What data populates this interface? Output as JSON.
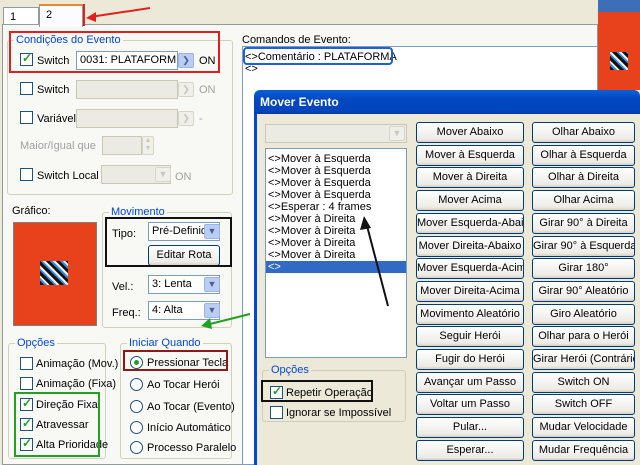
{
  "tabs": [
    "1",
    "2"
  ],
  "conditions": {
    "title": "Condições do Evento",
    "switch1": {
      "label": "Switch",
      "value": "0031: PLATAFORMM(",
      "suffix": "ON",
      "checked": true
    },
    "switch2": {
      "label": "Switch",
      "suffix": "ON"
    },
    "variable": {
      "label": "Variável",
      "suffix": "-"
    },
    "greater_equal_label": "Maior/Igual que",
    "local_switch": {
      "label": "Switch Local",
      "suffix": "ON"
    }
  },
  "graphic": {
    "label": "Gráfico:"
  },
  "movement": {
    "title": "Movimento",
    "type_label": "Tipo:",
    "type_value": "Pré-Definido",
    "edit_route": "Editar Rota",
    "speed_label": "Vel.:",
    "speed_value": "3: Lenta",
    "freq_label": "Freq.:",
    "freq_value": "4: Alta"
  },
  "options": {
    "title": "Opções",
    "items": [
      {
        "label": "Animação (Mov.)",
        "checked": false
      },
      {
        "label": "Animação (Fixa)",
        "checked": false
      },
      {
        "label": "Direção Fixa",
        "checked": true
      },
      {
        "label": "Atravessar",
        "checked": true
      },
      {
        "label": "Alta Prioridade",
        "checked": true
      }
    ]
  },
  "trigger": {
    "title": "Iniciar Quando",
    "items": [
      {
        "label": "Pressionar Tecla",
        "selected": true
      },
      {
        "label": "Ao Tocar Herói",
        "selected": false
      },
      {
        "label": "Ao Tocar (Evento)",
        "selected": false
      },
      {
        "label": "Início Automático",
        "selected": false
      },
      {
        "label": "Processo Paralelo",
        "selected": false
      }
    ]
  },
  "event_commands": {
    "label": "Comandos de Evento:",
    "lines": [
      "<>Comentário : PLATAFORMA",
      "<>"
    ]
  },
  "move_dialog": {
    "title": "Mover Evento",
    "route": [
      "<>Mover à Esquerda",
      "<>Mover à Esquerda",
      "<>Mover à Esquerda",
      "<>Mover à Esquerda",
      "<>Esperar : 4 frames",
      "<>Mover à Direita",
      "<>Mover à Direita",
      "<>Mover à Direita",
      "<>Mover à Direita",
      "<>"
    ],
    "options_title": "Opções",
    "repeat_label": "Repetir Operação",
    "ignore_label": "Ignorar se Impossível",
    "buttons_left": [
      "Mover Abaixo",
      "Mover à Esquerda",
      "Mover à Direita",
      "Mover Acima",
      "Mover Esquerda-Abaixo",
      "Mover Direita-Abaixo",
      "Mover Esquerda-Acima",
      "Mover Direita-Acima",
      "Movimento Aleatório",
      "Seguir Herói",
      "Fugir do Herói",
      "Avançar um Passo",
      "Voltar um Passo",
      "Pular...",
      "Esperar..."
    ],
    "buttons_right": [
      "Olhar Abaixo",
      "Olhar à Esquerda",
      "Olhar à Direita",
      "Olhar Acima",
      "Girar 90° à Direita",
      "Girar 90° à Esquerda",
      "Girar 180°",
      "Girar 90° Aleatório",
      "Giro Aleatório",
      "Olhar para o Herói",
      "Girar Herói (Contrário)",
      "Switch ON",
      "Switch OFF",
      "Mudar Velocidade",
      "Mudar Frequência"
    ]
  },
  "colors": {
    "accent_red": "#e02020",
    "accent_green": "#22a022",
    "sprite_bg": "#e8421c",
    "title_blue": "#0046d5"
  }
}
